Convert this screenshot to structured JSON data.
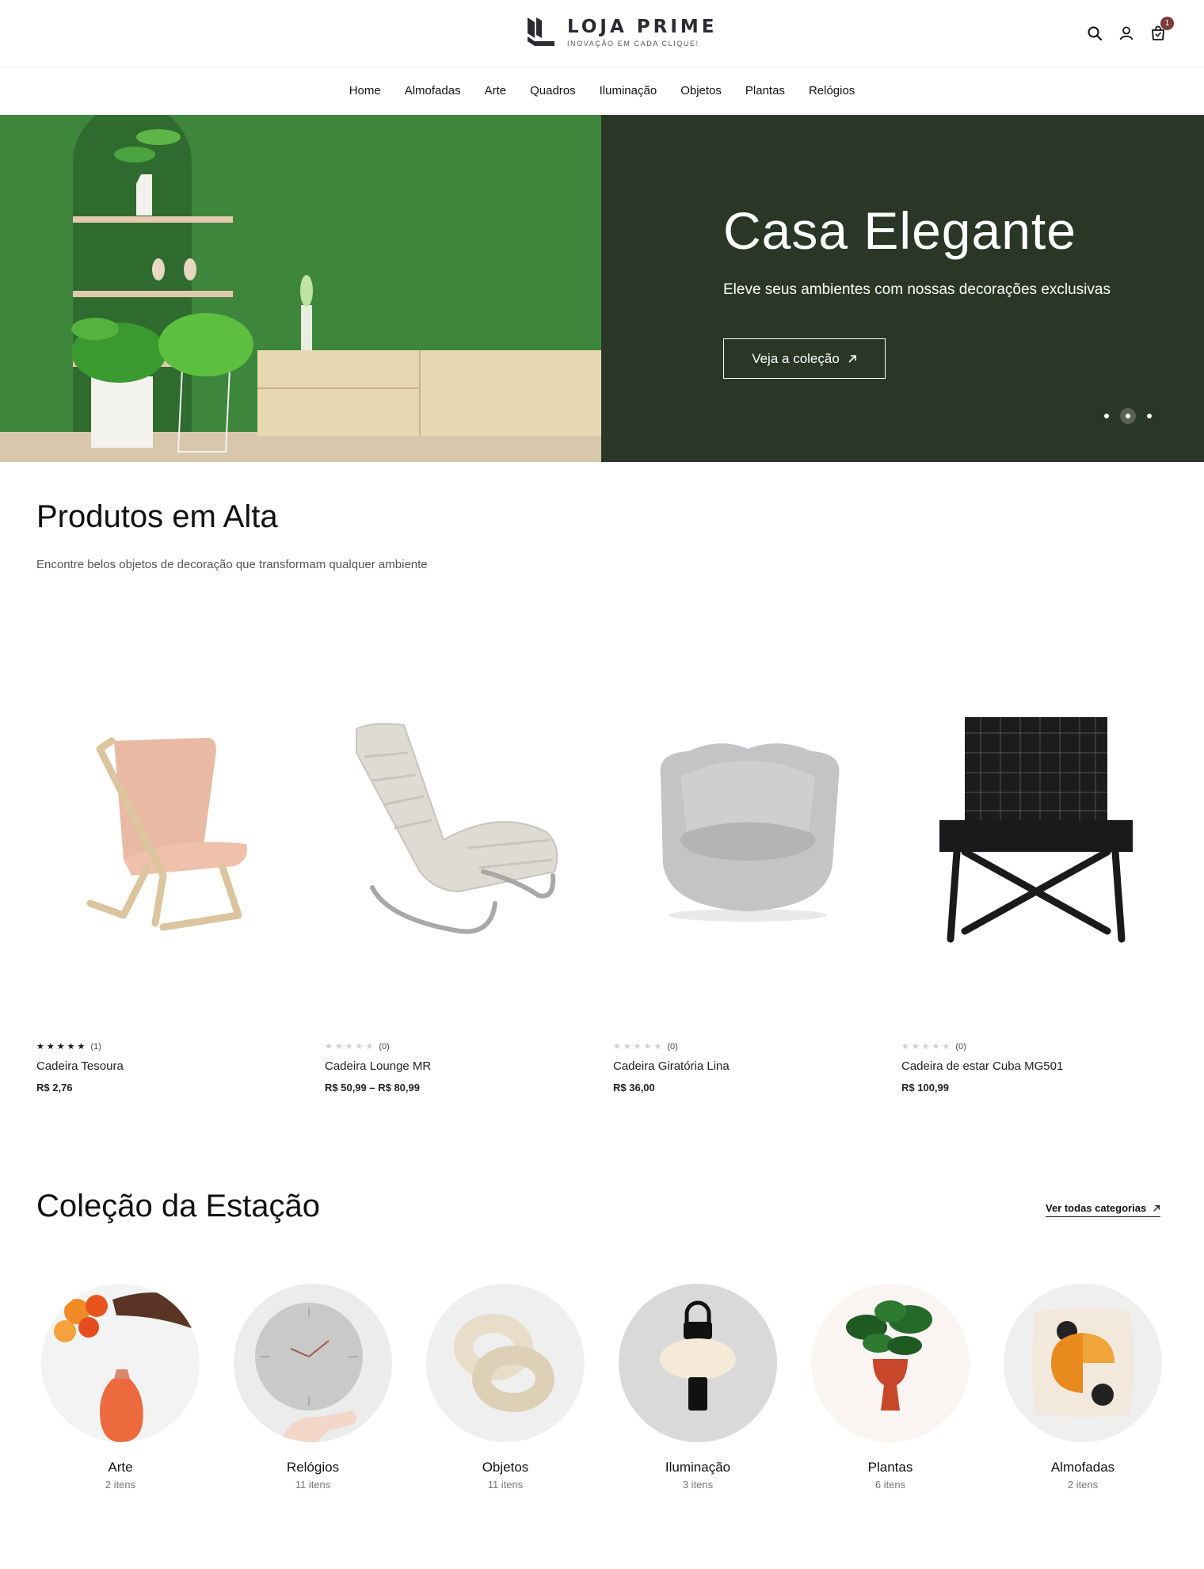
{
  "header": {
    "brand_name": "LOJA PRIME",
    "brand_tagline": "INOVAÇÃO EM CADA CLIQUE!",
    "cart_count": "1",
    "icons": [
      "search-icon",
      "user-icon",
      "cart-icon"
    ]
  },
  "nav": {
    "items": [
      "Home",
      "Almofadas",
      "Arte",
      "Quadros",
      "Iluminação",
      "Objetos",
      "Plantas",
      "Relógios"
    ]
  },
  "hero": {
    "title": "Casa Elegante",
    "subtitle": "Eleve seus ambientes com nossas decorações exclusivas",
    "button_label": "Veja a coleção",
    "slides": 3,
    "active_slide": 2,
    "panel_color": "#2a3727"
  },
  "trending": {
    "title": "Produtos em Alta",
    "subtitle": "Encontre belos objetos de decoração que transformam qualquer ambiente",
    "products": [
      {
        "name": "Cadeira Tesoura",
        "price": "R$ 2,76",
        "rating": 5,
        "reviews": "(1)"
      },
      {
        "name": "Cadeira Lounge MR",
        "price": "R$ 50,99  –  R$ 80,99",
        "rating": 0,
        "reviews": "(0)"
      },
      {
        "name": "Cadeira Giratória Lina",
        "price": "R$ 36,00",
        "rating": 0,
        "reviews": "(0)"
      },
      {
        "name": "Cadeira de estar Cuba MG501",
        "price": "R$ 100,99",
        "rating": 0,
        "reviews": "(0)"
      }
    ]
  },
  "collection": {
    "title": "Coleção da Estação",
    "view_all": "Ver todas categorias",
    "categories": [
      {
        "name": "Arte",
        "count": "2 itens"
      },
      {
        "name": "Relógios",
        "count": "11 itens"
      },
      {
        "name": "Objetos",
        "count": "11 itens"
      },
      {
        "name": "Iluminação",
        "count": "3 itens"
      },
      {
        "name": "Plantas",
        "count": "6 itens"
      },
      {
        "name": "Almofadas",
        "count": "2 itens"
      }
    ]
  }
}
